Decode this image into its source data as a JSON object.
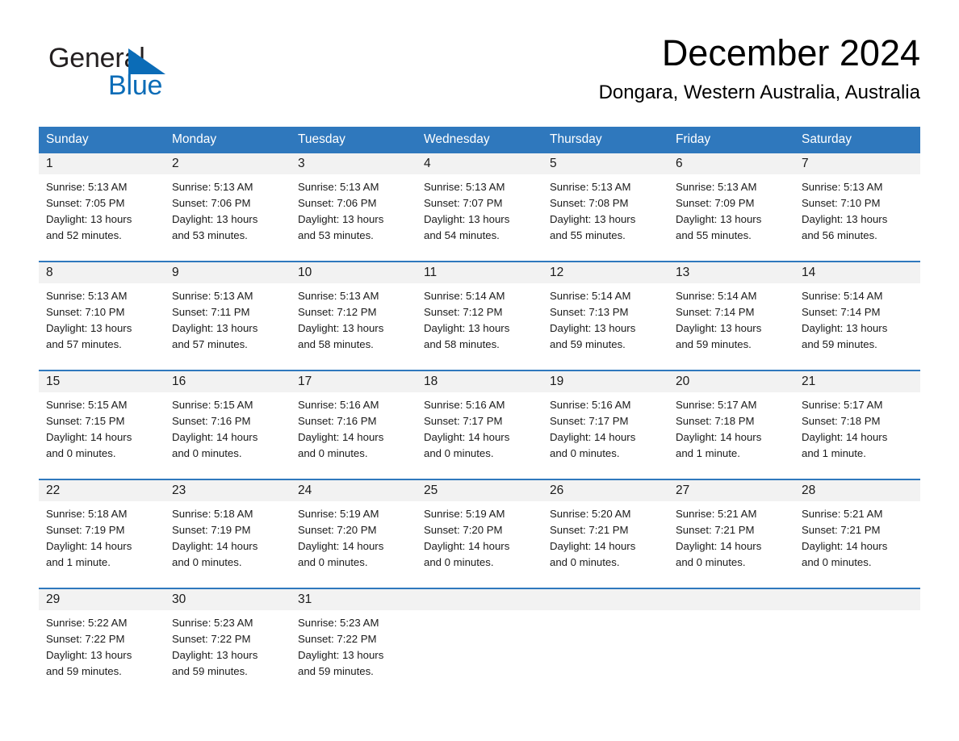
{
  "brand": {
    "word_one": "General",
    "word_two": "Blue",
    "triangle_icon": "triangle-logo-icon",
    "blue": "#0b6cb7",
    "dark": "#231f20"
  },
  "header": {
    "month_title": "December 2024",
    "location": "Dongara, Western Australia, Australia"
  },
  "theme": {
    "header_blue": "#2f78bd",
    "day_band_gray": "#f2f2f2",
    "text": "#1a1a1a"
  },
  "calendar": {
    "weekdays": [
      "Sunday",
      "Monday",
      "Tuesday",
      "Wednesday",
      "Thursday",
      "Friday",
      "Saturday"
    ],
    "weeks": [
      [
        {
          "day": "1",
          "sunrise": "Sunrise: 5:13 AM",
          "sunset": "Sunset: 7:05 PM",
          "daylight_1": "Daylight: 13 hours",
          "daylight_2": "and 52 minutes."
        },
        {
          "day": "2",
          "sunrise": "Sunrise: 5:13 AM",
          "sunset": "Sunset: 7:06 PM",
          "daylight_1": "Daylight: 13 hours",
          "daylight_2": "and 53 minutes."
        },
        {
          "day": "3",
          "sunrise": "Sunrise: 5:13 AM",
          "sunset": "Sunset: 7:06 PM",
          "daylight_1": "Daylight: 13 hours",
          "daylight_2": "and 53 minutes."
        },
        {
          "day": "4",
          "sunrise": "Sunrise: 5:13 AM",
          "sunset": "Sunset: 7:07 PM",
          "daylight_1": "Daylight: 13 hours",
          "daylight_2": "and 54 minutes."
        },
        {
          "day": "5",
          "sunrise": "Sunrise: 5:13 AM",
          "sunset": "Sunset: 7:08 PM",
          "daylight_1": "Daylight: 13 hours",
          "daylight_2": "and 55 minutes."
        },
        {
          "day": "6",
          "sunrise": "Sunrise: 5:13 AM",
          "sunset": "Sunset: 7:09 PM",
          "daylight_1": "Daylight: 13 hours",
          "daylight_2": "and 55 minutes."
        },
        {
          "day": "7",
          "sunrise": "Sunrise: 5:13 AM",
          "sunset": "Sunset: 7:10 PM",
          "daylight_1": "Daylight: 13 hours",
          "daylight_2": "and 56 minutes."
        }
      ],
      [
        {
          "day": "8",
          "sunrise": "Sunrise: 5:13 AM",
          "sunset": "Sunset: 7:10 PM",
          "daylight_1": "Daylight: 13 hours",
          "daylight_2": "and 57 minutes."
        },
        {
          "day": "9",
          "sunrise": "Sunrise: 5:13 AM",
          "sunset": "Sunset: 7:11 PM",
          "daylight_1": "Daylight: 13 hours",
          "daylight_2": "and 57 minutes."
        },
        {
          "day": "10",
          "sunrise": "Sunrise: 5:13 AM",
          "sunset": "Sunset: 7:12 PM",
          "daylight_1": "Daylight: 13 hours",
          "daylight_2": "and 58 minutes."
        },
        {
          "day": "11",
          "sunrise": "Sunrise: 5:14 AM",
          "sunset": "Sunset: 7:12 PM",
          "daylight_1": "Daylight: 13 hours",
          "daylight_2": "and 58 minutes."
        },
        {
          "day": "12",
          "sunrise": "Sunrise: 5:14 AM",
          "sunset": "Sunset: 7:13 PM",
          "daylight_1": "Daylight: 13 hours",
          "daylight_2": "and 59 minutes."
        },
        {
          "day": "13",
          "sunrise": "Sunrise: 5:14 AM",
          "sunset": "Sunset: 7:14 PM",
          "daylight_1": "Daylight: 13 hours",
          "daylight_2": "and 59 minutes."
        },
        {
          "day": "14",
          "sunrise": "Sunrise: 5:14 AM",
          "sunset": "Sunset: 7:14 PM",
          "daylight_1": "Daylight: 13 hours",
          "daylight_2": "and 59 minutes."
        }
      ],
      [
        {
          "day": "15",
          "sunrise": "Sunrise: 5:15 AM",
          "sunset": "Sunset: 7:15 PM",
          "daylight_1": "Daylight: 14 hours",
          "daylight_2": "and 0 minutes."
        },
        {
          "day": "16",
          "sunrise": "Sunrise: 5:15 AM",
          "sunset": "Sunset: 7:16 PM",
          "daylight_1": "Daylight: 14 hours",
          "daylight_2": "and 0 minutes."
        },
        {
          "day": "17",
          "sunrise": "Sunrise: 5:16 AM",
          "sunset": "Sunset: 7:16 PM",
          "daylight_1": "Daylight: 14 hours",
          "daylight_2": "and 0 minutes."
        },
        {
          "day": "18",
          "sunrise": "Sunrise: 5:16 AM",
          "sunset": "Sunset: 7:17 PM",
          "daylight_1": "Daylight: 14 hours",
          "daylight_2": "and 0 minutes."
        },
        {
          "day": "19",
          "sunrise": "Sunrise: 5:16 AM",
          "sunset": "Sunset: 7:17 PM",
          "daylight_1": "Daylight: 14 hours",
          "daylight_2": "and 0 minutes."
        },
        {
          "day": "20",
          "sunrise": "Sunrise: 5:17 AM",
          "sunset": "Sunset: 7:18 PM",
          "daylight_1": "Daylight: 14 hours",
          "daylight_2": "and 1 minute."
        },
        {
          "day": "21",
          "sunrise": "Sunrise: 5:17 AM",
          "sunset": "Sunset: 7:18 PM",
          "daylight_1": "Daylight: 14 hours",
          "daylight_2": "and 1 minute."
        }
      ],
      [
        {
          "day": "22",
          "sunrise": "Sunrise: 5:18 AM",
          "sunset": "Sunset: 7:19 PM",
          "daylight_1": "Daylight: 14 hours",
          "daylight_2": "and 1 minute."
        },
        {
          "day": "23",
          "sunrise": "Sunrise: 5:18 AM",
          "sunset": "Sunset: 7:19 PM",
          "daylight_1": "Daylight: 14 hours",
          "daylight_2": "and 0 minutes."
        },
        {
          "day": "24",
          "sunrise": "Sunrise: 5:19 AM",
          "sunset": "Sunset: 7:20 PM",
          "daylight_1": "Daylight: 14 hours",
          "daylight_2": "and 0 minutes."
        },
        {
          "day": "25",
          "sunrise": "Sunrise: 5:19 AM",
          "sunset": "Sunset: 7:20 PM",
          "daylight_1": "Daylight: 14 hours",
          "daylight_2": "and 0 minutes."
        },
        {
          "day": "26",
          "sunrise": "Sunrise: 5:20 AM",
          "sunset": "Sunset: 7:21 PM",
          "daylight_1": "Daylight: 14 hours",
          "daylight_2": "and 0 minutes."
        },
        {
          "day": "27",
          "sunrise": "Sunrise: 5:21 AM",
          "sunset": "Sunset: 7:21 PM",
          "daylight_1": "Daylight: 14 hours",
          "daylight_2": "and 0 minutes."
        },
        {
          "day": "28",
          "sunrise": "Sunrise: 5:21 AM",
          "sunset": "Sunset: 7:21 PM",
          "daylight_1": "Daylight: 14 hours",
          "daylight_2": "and 0 minutes."
        }
      ],
      [
        {
          "day": "29",
          "sunrise": "Sunrise: 5:22 AM",
          "sunset": "Sunset: 7:22 PM",
          "daylight_1": "Daylight: 13 hours",
          "daylight_2": "and 59 minutes."
        },
        {
          "day": "30",
          "sunrise": "Sunrise: 5:23 AM",
          "sunset": "Sunset: 7:22 PM",
          "daylight_1": "Daylight: 13 hours",
          "daylight_2": "and 59 minutes."
        },
        {
          "day": "31",
          "sunrise": "Sunrise: 5:23 AM",
          "sunset": "Sunset: 7:22 PM",
          "daylight_1": "Daylight: 13 hours",
          "daylight_2": "and 59 minutes."
        },
        {
          "day": "",
          "sunrise": "",
          "sunset": "",
          "daylight_1": "",
          "daylight_2": ""
        },
        {
          "day": "",
          "sunrise": "",
          "sunset": "",
          "daylight_1": "",
          "daylight_2": ""
        },
        {
          "day": "",
          "sunrise": "",
          "sunset": "",
          "daylight_1": "",
          "daylight_2": ""
        },
        {
          "day": "",
          "sunrise": "",
          "sunset": "",
          "daylight_1": "",
          "daylight_2": ""
        }
      ]
    ]
  }
}
